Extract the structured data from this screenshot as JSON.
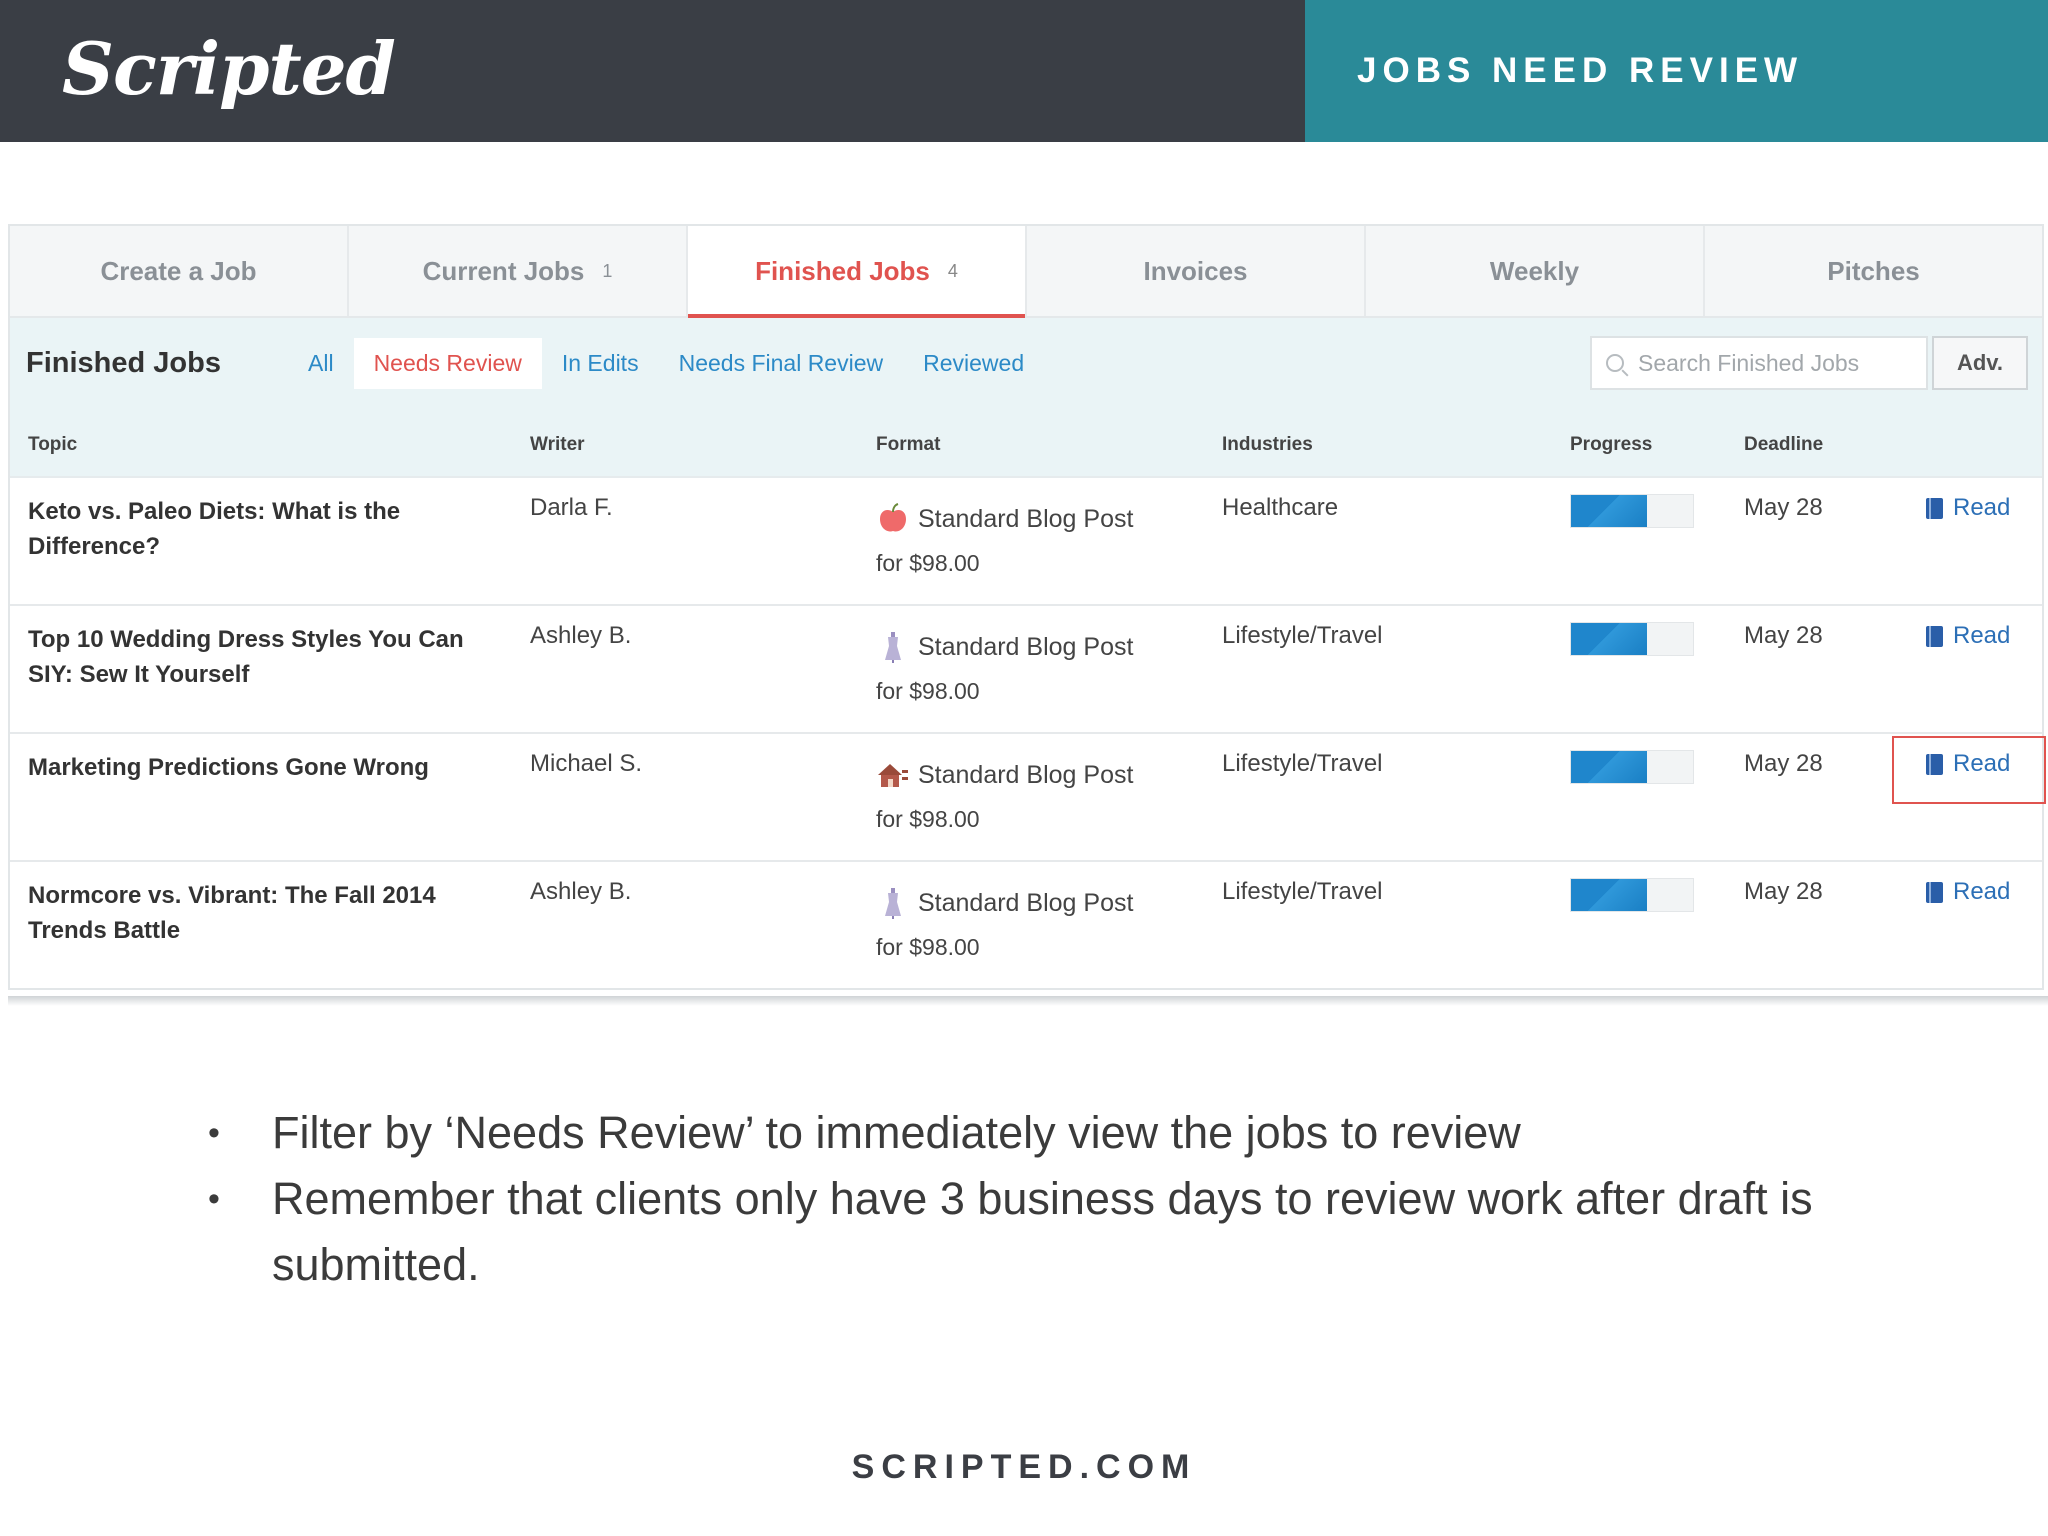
{
  "header": {
    "logo": "Scripted",
    "title": "JOBS NEED REVIEW"
  },
  "tabs": [
    {
      "label": "Create a Job",
      "count": ""
    },
    {
      "label": "Current Jobs",
      "count": "1"
    },
    {
      "label": "Finished Jobs",
      "count": "4"
    },
    {
      "label": "Invoices",
      "count": ""
    },
    {
      "label": "Weekly",
      "count": ""
    },
    {
      "label": "Pitches",
      "count": ""
    }
  ],
  "active_tab": "Finished Jobs",
  "filterbar": {
    "title": "Finished Jobs",
    "filters": [
      "All",
      "Needs Review",
      "In Edits",
      "Needs Final Review",
      "Reviewed"
    ],
    "active_filter": "Needs Review",
    "search_placeholder": "Search Finished Jobs",
    "adv_label": "Adv."
  },
  "table": {
    "columns": [
      "Topic",
      "Writer",
      "Format",
      "Industries",
      "Progress",
      "Deadline"
    ],
    "rows": [
      {
        "topic": "Keto vs. Paleo Diets: What is the Difference?",
        "writer": "Darla F.",
        "format": "Standard Blog Post",
        "price": "for $98.00",
        "industry": "Healthcare",
        "progress": 0.62,
        "deadline": "May 28",
        "action": "Read",
        "icon": "apple-icon"
      },
      {
        "topic": "Top 10 Wedding Dress Styles You Can SIY: Sew It Yourself",
        "writer": "Ashley B.",
        "format": "Standard Blog Post",
        "price": "for $98.00",
        "industry": "Lifestyle/Travel",
        "progress": 0.62,
        "deadline": "May 28",
        "action": "Read",
        "icon": "dress-form-icon"
      },
      {
        "topic": "Marketing Predictions Gone Wrong",
        "writer": "Michael S.",
        "format": "Standard Blog Post",
        "price": "for $98.00",
        "industry": "Lifestyle/Travel",
        "progress": 0.62,
        "deadline": "May 28",
        "action": "Read",
        "icon": "house-icon"
      },
      {
        "topic": "Normcore vs. Vibrant: The Fall 2014 Trends Battle",
        "writer": "Ashley B.",
        "format": "Standard Blog Post",
        "price": "for $98.00",
        "industry": "Lifestyle/Travel",
        "progress": 0.62,
        "deadline": "May 28",
        "action": "Read",
        "icon": "dress-form-icon"
      }
    ]
  },
  "bullets": [
    "Filter by ‘Needs Review’ to immediately view the jobs to review",
    "Remember that clients only have 3 business days to review work after draft is submitted."
  ],
  "footer": "SCRIPTED.COM",
  "colors": {
    "header_dark": "#3a3e45",
    "header_teal": "#2a8a98",
    "accent_red": "#e0534f",
    "link_blue": "#2c8ac7",
    "progress_blue": "#1f86cc"
  }
}
